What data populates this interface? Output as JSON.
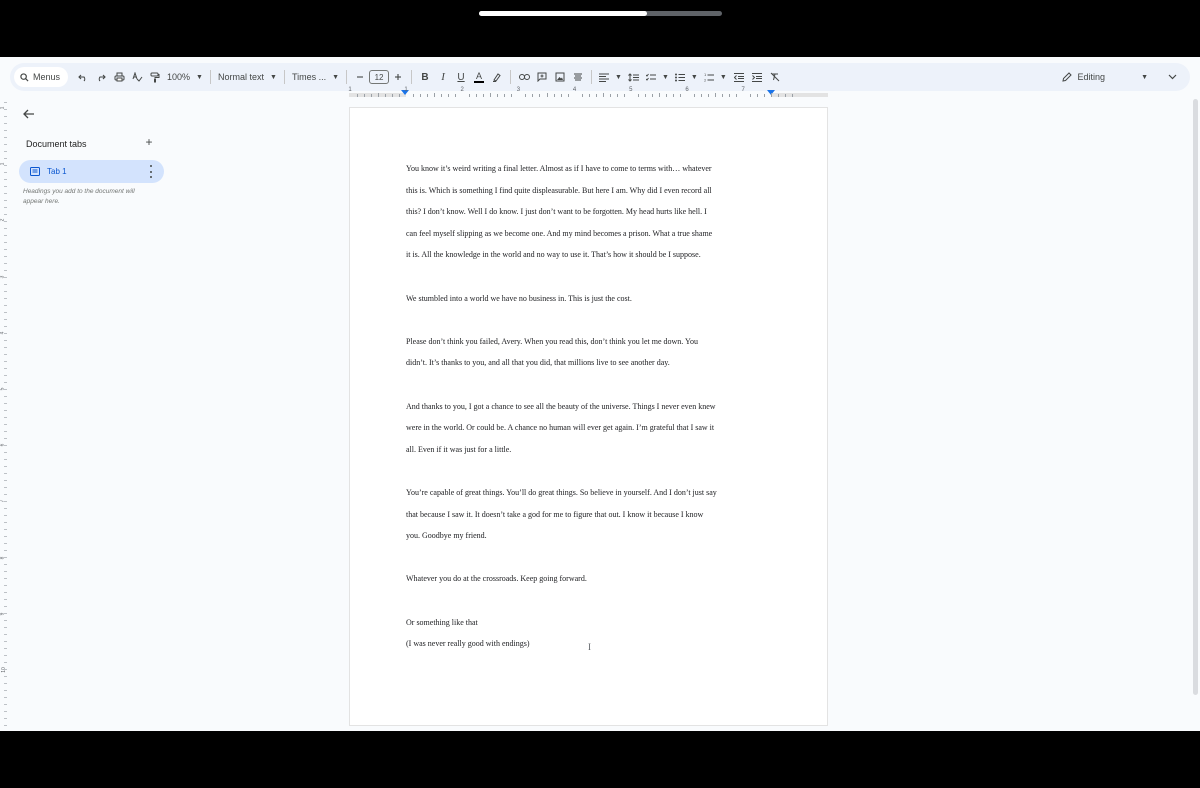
{
  "video": {
    "progress": 0.69
  },
  "toolbar": {
    "menus_label": "Menus",
    "zoom": "100%",
    "style": "Normal text",
    "font": "Times ...",
    "font_size": "12",
    "bold": "B",
    "italic": "I",
    "underline": "U",
    "text_color": "A",
    "mode": "Editing"
  },
  "ruler": {
    "numbers": [
      "1",
      "1",
      "2",
      "3",
      "4",
      "5",
      "6",
      "7"
    ]
  },
  "vruler": {
    "numbers": [
      "1",
      "1",
      "2",
      "3",
      "4",
      "5",
      "6",
      "7",
      "8",
      "9",
      "10"
    ]
  },
  "sidebar": {
    "title": "Document tabs",
    "add": "+",
    "tab_label": "Tab 1",
    "hint": "Headings you add to the document will appear here."
  },
  "document": {
    "lines": [
      "You know it’s weird writing a final letter. Almost as if I have to come to terms with… whatever",
      "this is. Which is something I find quite displeasurable. But here I am. Why did I even record all",
      "this? I don’t know. Well I do know. I just don’t want to be forgotten. My head hurts like hell. I",
      "can feel myself slipping as we become one. And my mind becomes a prison. What a true shame",
      "it is. All the knowledge in the world and no way to use it. That’s how it should be I suppose.",
      "",
      "We stumbled into a world we have no business in. This is just the cost.",
      "",
      "Please don’t think you failed, Avery. When you read this, don’t think you let me down. You",
      "didn’t. It’s thanks to you, and all that you did, that millions live to see another day.",
      "",
      "And thanks to you, I got a chance to see all the beauty of the universe. Things I never even knew",
      "were in the world. Or could be. A chance no human will ever get again. I’m grateful that I saw it",
      "all. Even if it was just for a little.",
      "",
      "You’re capable of great things. You’ll do great things. So believe in yourself. And I don’t just say",
      "that because I saw it. It doesn’t take a god for me to figure that out. I know it because I know",
      "you. Goodbye my friend.",
      "",
      "Whatever you do at the crossroads. Keep going forward.",
      "",
      "Or something like that",
      "(I was never really good with endings)"
    ],
    "cursor": "I"
  }
}
